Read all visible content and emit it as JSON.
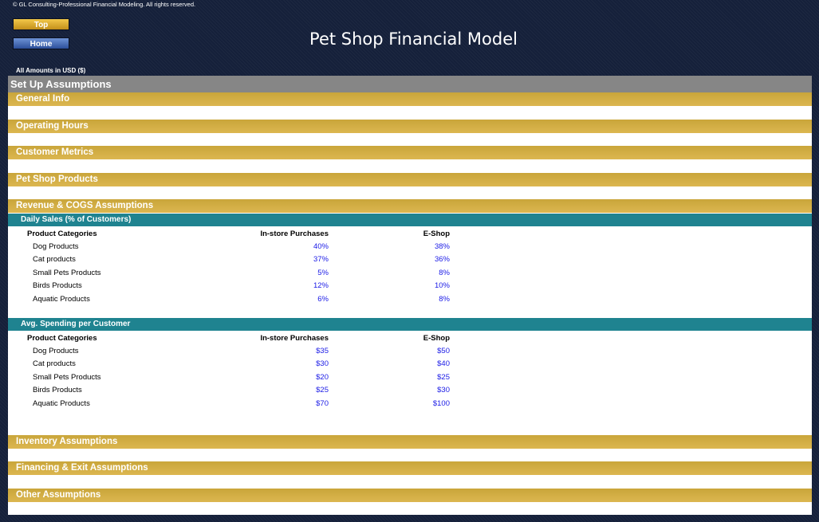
{
  "copyright": "© GL Consulting-Professional Financial Modeling. All rights reserved.",
  "nav": {
    "top_label": "Top",
    "home_label": "Home"
  },
  "title": "Pet Shop Financial Model",
  "amounts_note": "All Amounts in  USD ($)",
  "setup_header": "Set Up Assumptions",
  "sections": {
    "general_info": "General Info",
    "operating_hours": "Operating Hours",
    "customer_metrics": "Customer Metrics",
    "pet_shop_products": "Pet Shop Products",
    "revenue_cogs": "Revenue & COGS Assumptions",
    "inventory": "Inventory Assumptions",
    "financing_exit": "Financing & Exit Assumptions",
    "other": "Other Assumptions"
  },
  "daily_sales": {
    "title": "Daily Sales (% of Customers)",
    "headers": {
      "category": "Product Categories",
      "in_store": "In-store Purchases",
      "eshop": "E-Shop"
    },
    "rows": [
      {
        "name": "Dog Products",
        "in_store": "40%",
        "eshop": "38%"
      },
      {
        "name": "Cat products",
        "in_store": "37%",
        "eshop": "36%"
      },
      {
        "name": "Small Pets Products",
        "in_store": "5%",
        "eshop": "8%"
      },
      {
        "name": "Birds Products",
        "in_store": "12%",
        "eshop": "10%"
      },
      {
        "name": "Aquatic Products",
        "in_store": "6%",
        "eshop": "8%"
      }
    ]
  },
  "avg_spending": {
    "title": "Avg. Spending per Customer",
    "headers": {
      "category": "Product Categories",
      "in_store": "In-store Purchases",
      "eshop": "E-Shop"
    },
    "rows": [
      {
        "name": "Dog Products",
        "in_store": "$35",
        "eshop": "$50"
      },
      {
        "name": "Cat products",
        "in_store": "$30",
        "eshop": "$40"
      },
      {
        "name": "Small Pets Products",
        "in_store": "$20",
        "eshop": "$25"
      },
      {
        "name": "Birds Products",
        "in_store": "$25",
        "eshop": "$30"
      },
      {
        "name": "Aquatic Products",
        "in_store": "$70",
        "eshop": "$100"
      }
    ]
  },
  "colors": {
    "background": "#15203a",
    "gold_band": "#d2ae45",
    "gray_band": "#868686",
    "teal_band": "#1f8390",
    "value_text": "#1a1ae6"
  }
}
